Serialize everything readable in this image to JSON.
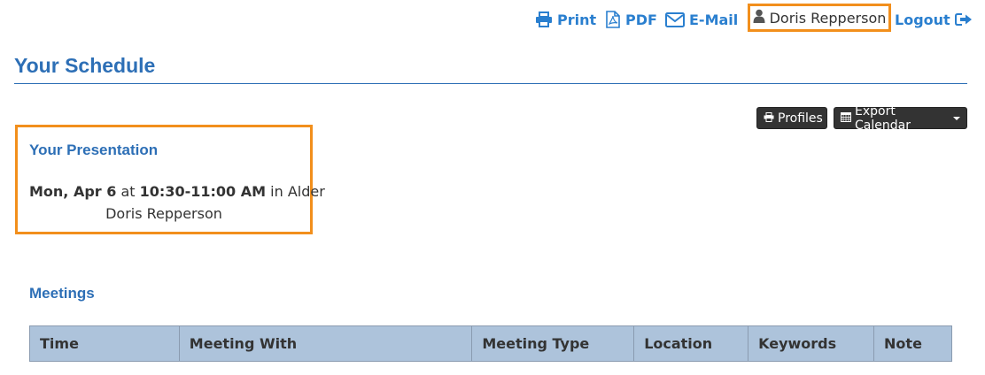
{
  "topbar": {
    "print_label": "Print",
    "pdf_label": "PDF",
    "email_label": "E-Mail",
    "user_name": "Doris Repperson",
    "logout_label": "Logout"
  },
  "header": {
    "title": "Your Schedule"
  },
  "toolbar": {
    "profiles_label": "Profiles",
    "export_label": "Export Calendar"
  },
  "presentation": {
    "heading": "Your Presentation",
    "date": "Mon, Apr 6",
    "at_word": "at",
    "time": "10:30-11:00 AM",
    "in_word": "in",
    "room": "Alder",
    "presenter": "Doris Repperson"
  },
  "meetings": {
    "heading": "Meetings",
    "columns": [
      "Time",
      "Meeting With",
      "Meeting Type",
      "Location",
      "Keywords",
      "Note"
    ]
  },
  "colors": {
    "accent_blue": "#2d6fb6",
    "link_blue": "#2a7fcf",
    "highlight_orange": "#f28f1c",
    "table_header_bg": "#adc3db",
    "button_dark": "#333333"
  }
}
